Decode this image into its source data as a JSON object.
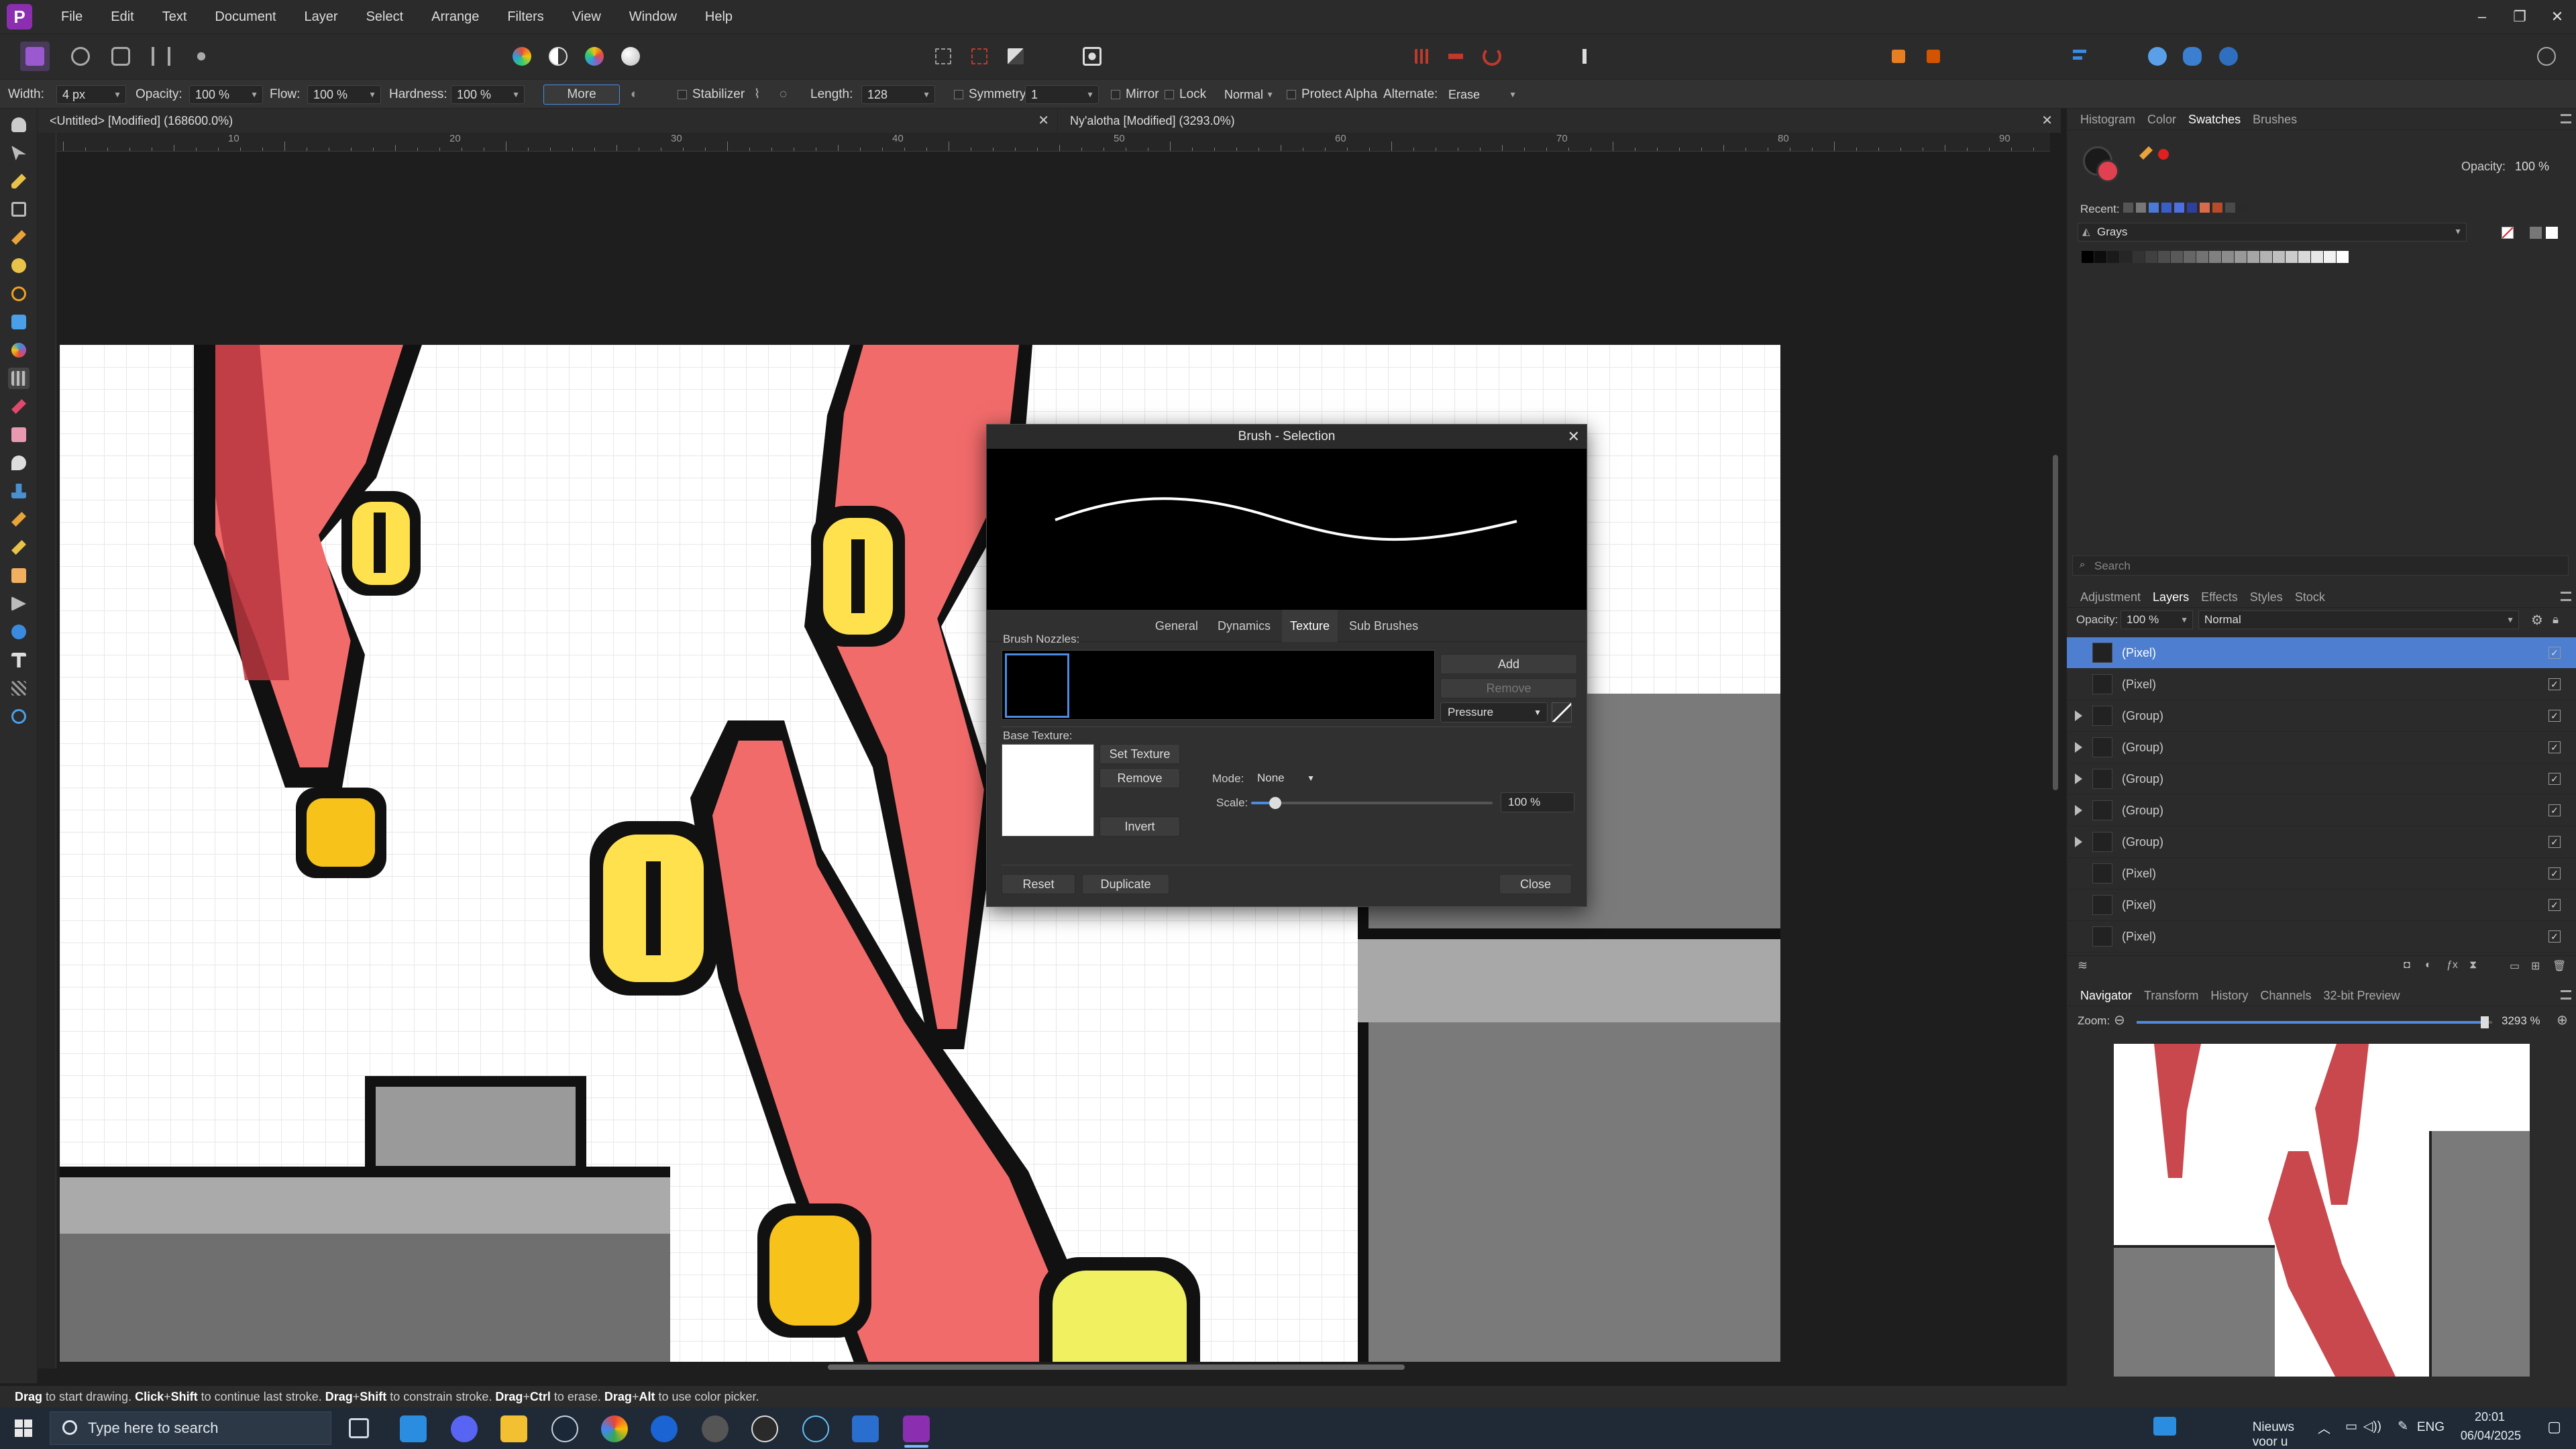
{
  "menubar": {
    "logo": "P",
    "items": [
      "File",
      "Edit",
      "Text",
      "Document",
      "Layer",
      "Select",
      "Arrange",
      "Filters",
      "View",
      "Window",
      "Help"
    ],
    "window_controls": {
      "minimize": "–",
      "restore": "❐",
      "close": "✕"
    }
  },
  "context": {
    "width_label": "Width:",
    "width_value": "4 px",
    "opacity_label": "Opacity:",
    "opacity_value": "100 %",
    "flow_label": "Flow:",
    "flow_value": "100 %",
    "hardness_label": "Hardness:",
    "hardness_value": "100 %",
    "more_label": "More",
    "stabilizer_label": "Stabilizer",
    "length_label": "Length:",
    "length_value": "128",
    "symmetry_label": "Symmetry",
    "symmetry_value": "1",
    "mirror_label": "Mirror",
    "lock_label": "Lock",
    "blend_value": "Normal",
    "protect_alpha_label": "Protect Alpha",
    "alternate_label": "Alternate:",
    "alternate_value": "Erase"
  },
  "tabs": [
    {
      "label": "<Untitled> [Modified] (168600.0%)"
    },
    {
      "label": "Ny'alotha [Modified] (3293.0%)"
    }
  ],
  "ruler": {
    "labels": [
      "10",
      "20",
      "30",
      "40",
      "50",
      "60",
      "70",
      "80",
      "90"
    ]
  },
  "dialog": {
    "title": "Brush - Selection",
    "tabs": [
      "General",
      "Dynamics",
      "Texture",
      "Sub Brushes"
    ],
    "active_tab": "Texture",
    "nozzles_label": "Brush Nozzles:",
    "add_label": "Add",
    "remove_nozzle_label": "Remove",
    "pressure_value": "Pressure",
    "base_texture_label": "Base Texture:",
    "set_texture_label": "Set Texture",
    "remove_texture_label": "Remove",
    "invert_label": "Invert",
    "mode_label": "Mode:",
    "mode_value": "None",
    "scale_label": "Scale:",
    "scale_value": "100 %",
    "scale_fraction": 0.1,
    "reset_label": "Reset",
    "duplicate_label": "Duplicate",
    "close_label": "Close"
  },
  "colour_panel": {
    "tabs": [
      "Histogram",
      "Color",
      "Swatches",
      "Brushes"
    ],
    "active_tab": "Swatches",
    "opacity_label": "Opacity:",
    "opacity_value": "100 %",
    "recent_label": "Recent:",
    "recent_colors": [
      "#555555",
      "#777777",
      "#4a79d8",
      "#3a5ec8",
      "#4e6fe0",
      "#2e3f9c",
      "#d96b4a",
      "#b84b2a",
      "#4a4a4a",
      "#2a2a2a"
    ],
    "palette_name": "Grays",
    "grays": [
      "#000000",
      "#0d0d0d",
      "#1a1a1a",
      "#262626",
      "#333333",
      "#404040",
      "#4d4d4d",
      "#595959",
      "#666666",
      "#737373",
      "#808080",
      "#8c8c8c",
      "#999999",
      "#a6a6a6",
      "#b3b3b3",
      "#bfbfbf",
      "#cccccc",
      "#d9d9d9",
      "#e6e6e6",
      "#f2f2f2",
      "#ffffff"
    ],
    "search_placeholder": "Search"
  },
  "layers_panel": {
    "tabs": [
      "Adjustment",
      "Layers",
      "Effects",
      "Styles",
      "Stock"
    ],
    "active_tab": "Layers",
    "opacity_label": "Opacity:",
    "opacity_value": "100 %",
    "blend_value": "Normal",
    "layers": [
      {
        "name": "(Pixel)",
        "group": false,
        "selected": true
      },
      {
        "name": "(Pixel)",
        "group": false,
        "selected": false
      },
      {
        "name": "(Group)",
        "group": true,
        "selected": false
      },
      {
        "name": "(Group)",
        "group": true,
        "selected": false
      },
      {
        "name": "(Group)",
        "group": true,
        "selected": false
      },
      {
        "name": "(Group)",
        "group": true,
        "selected": false
      },
      {
        "name": "(Group)",
        "group": true,
        "selected": false
      },
      {
        "name": "(Pixel)",
        "group": false,
        "selected": false
      },
      {
        "name": "(Pixel)",
        "group": false,
        "selected": false
      },
      {
        "name": "(Pixel)",
        "group": false,
        "selected": false
      }
    ]
  },
  "navigator_panel": {
    "tabs": [
      "Navigator",
      "Transform",
      "History",
      "Channels",
      "32-bit Preview"
    ],
    "active_tab": "Navigator",
    "zoom_label": "Zoom:",
    "zoom_value": "3293 %",
    "zoom_fraction": 0.98
  },
  "status": {
    "parts": [
      {
        "b": "Drag",
        "t": " to start drawing. "
      },
      {
        "b": "Click",
        "t": "+"
      },
      {
        "b": "Shift",
        "t": " to continue last stroke. "
      },
      {
        "b": "Drag",
        "t": "+"
      },
      {
        "b": "Shift",
        "t": " to constrain stroke. "
      },
      {
        "b": "Drag",
        "t": "+"
      },
      {
        "b": "Ctrl",
        "t": " to erase. "
      },
      {
        "b": "Drag",
        "t": "+"
      },
      {
        "b": "Alt",
        "t": " to use color picker."
      }
    ]
  },
  "taskbar": {
    "search_placeholder": "Type here to search",
    "news": "Nieuws voor u",
    "lang": "ENG",
    "time": "20:01",
    "date": "06/04/2025"
  },
  "colors": {
    "accent": "#4d7ed0",
    "tentacle": "#f26b6b",
    "tentacle_dark": "#b8363f",
    "eye": "#ffe14d",
    "eye_dark": "#f0a500",
    "stone": "#9a9a9a"
  }
}
